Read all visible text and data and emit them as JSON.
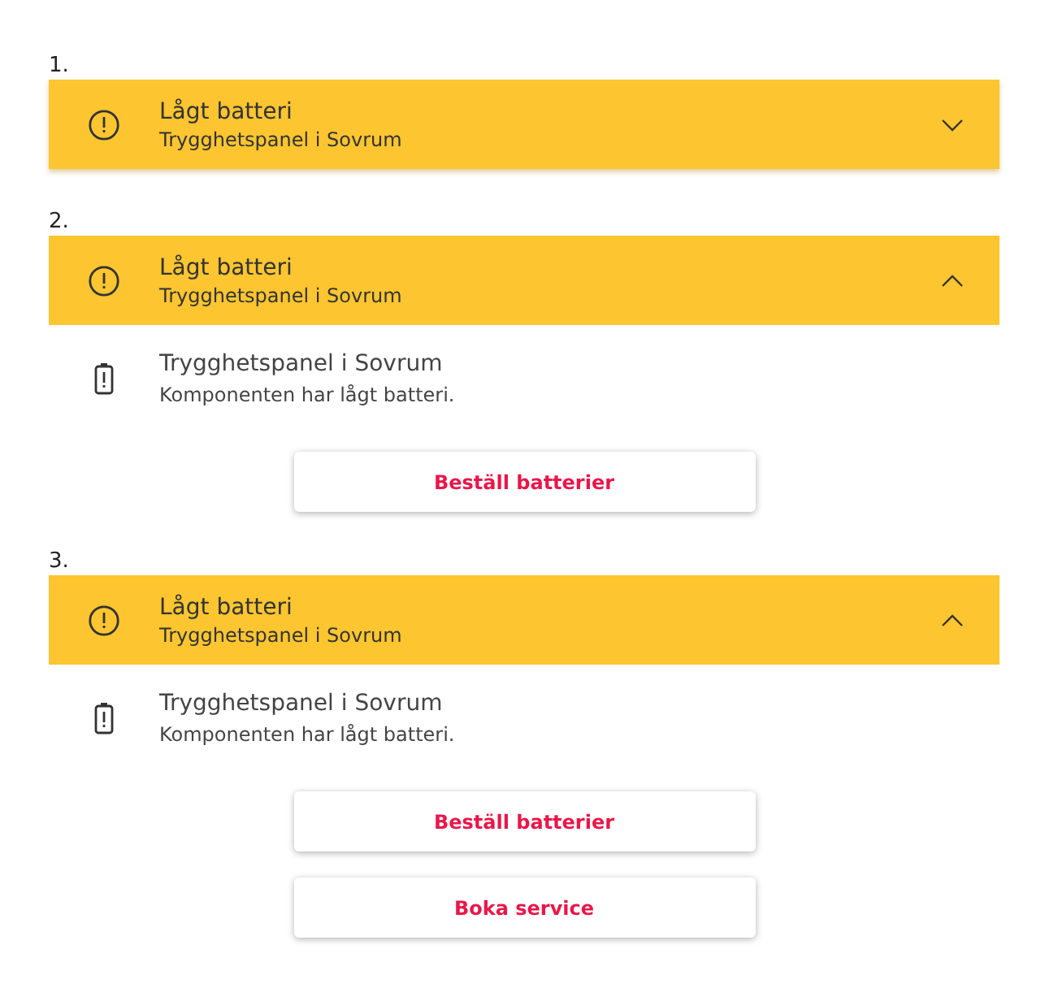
{
  "examples": [
    {
      "number": "1.",
      "expanded": false,
      "title": "Lågt batteri",
      "subtitle": "Trygghetspanel i Sovrum"
    },
    {
      "number": "2.",
      "expanded": true,
      "title": "Lågt batteri",
      "subtitle": "Trygghetspanel i Sovrum",
      "detail": {
        "title": "Trygghetspanel i Sovrum",
        "text": "Komponenten har lågt batteri."
      },
      "buttons": [
        "Beställ batterier"
      ]
    },
    {
      "number": "3.",
      "expanded": true,
      "title": "Lågt batteri",
      "subtitle": "Trygghetspanel i Sovrum",
      "detail": {
        "title": "Trygghetspanel i Sovrum",
        "text": "Komponenten har lågt batteri."
      },
      "buttons": [
        "Beställ batterier",
        "Boka service"
      ]
    }
  ]
}
